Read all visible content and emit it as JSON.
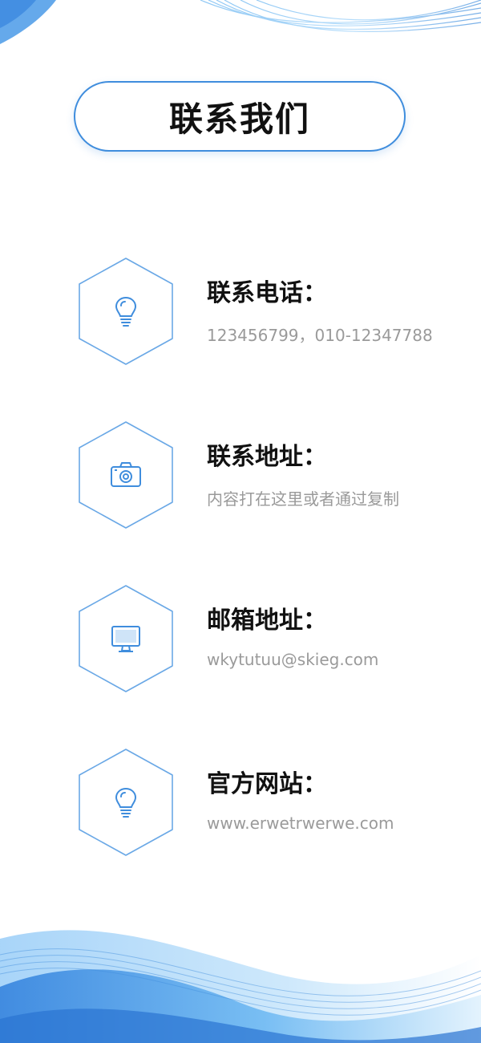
{
  "title": "联系我们",
  "items": [
    {
      "title": "联系电话：",
      "value": "123456799，010-12347788",
      "icon": "lightbulb-icon"
    },
    {
      "title": "联系地址：",
      "value": "内容打在这里或者通过复制",
      "icon": "camera-icon"
    },
    {
      "title": "邮箱地址：",
      "value": "wkytutuu@skieg.com",
      "icon": "monitor-icon"
    },
    {
      "title": "官方网站：",
      "value": "www.erwetrwerwe.com",
      "icon": "lightbulb-icon"
    }
  ],
  "colors": {
    "accent": "#3f8ddd",
    "title_text": "#111111",
    "value_text": "#9a9a9a",
    "wave_light": "#bfe3fb",
    "wave_dark": "#2f7fdc"
  }
}
